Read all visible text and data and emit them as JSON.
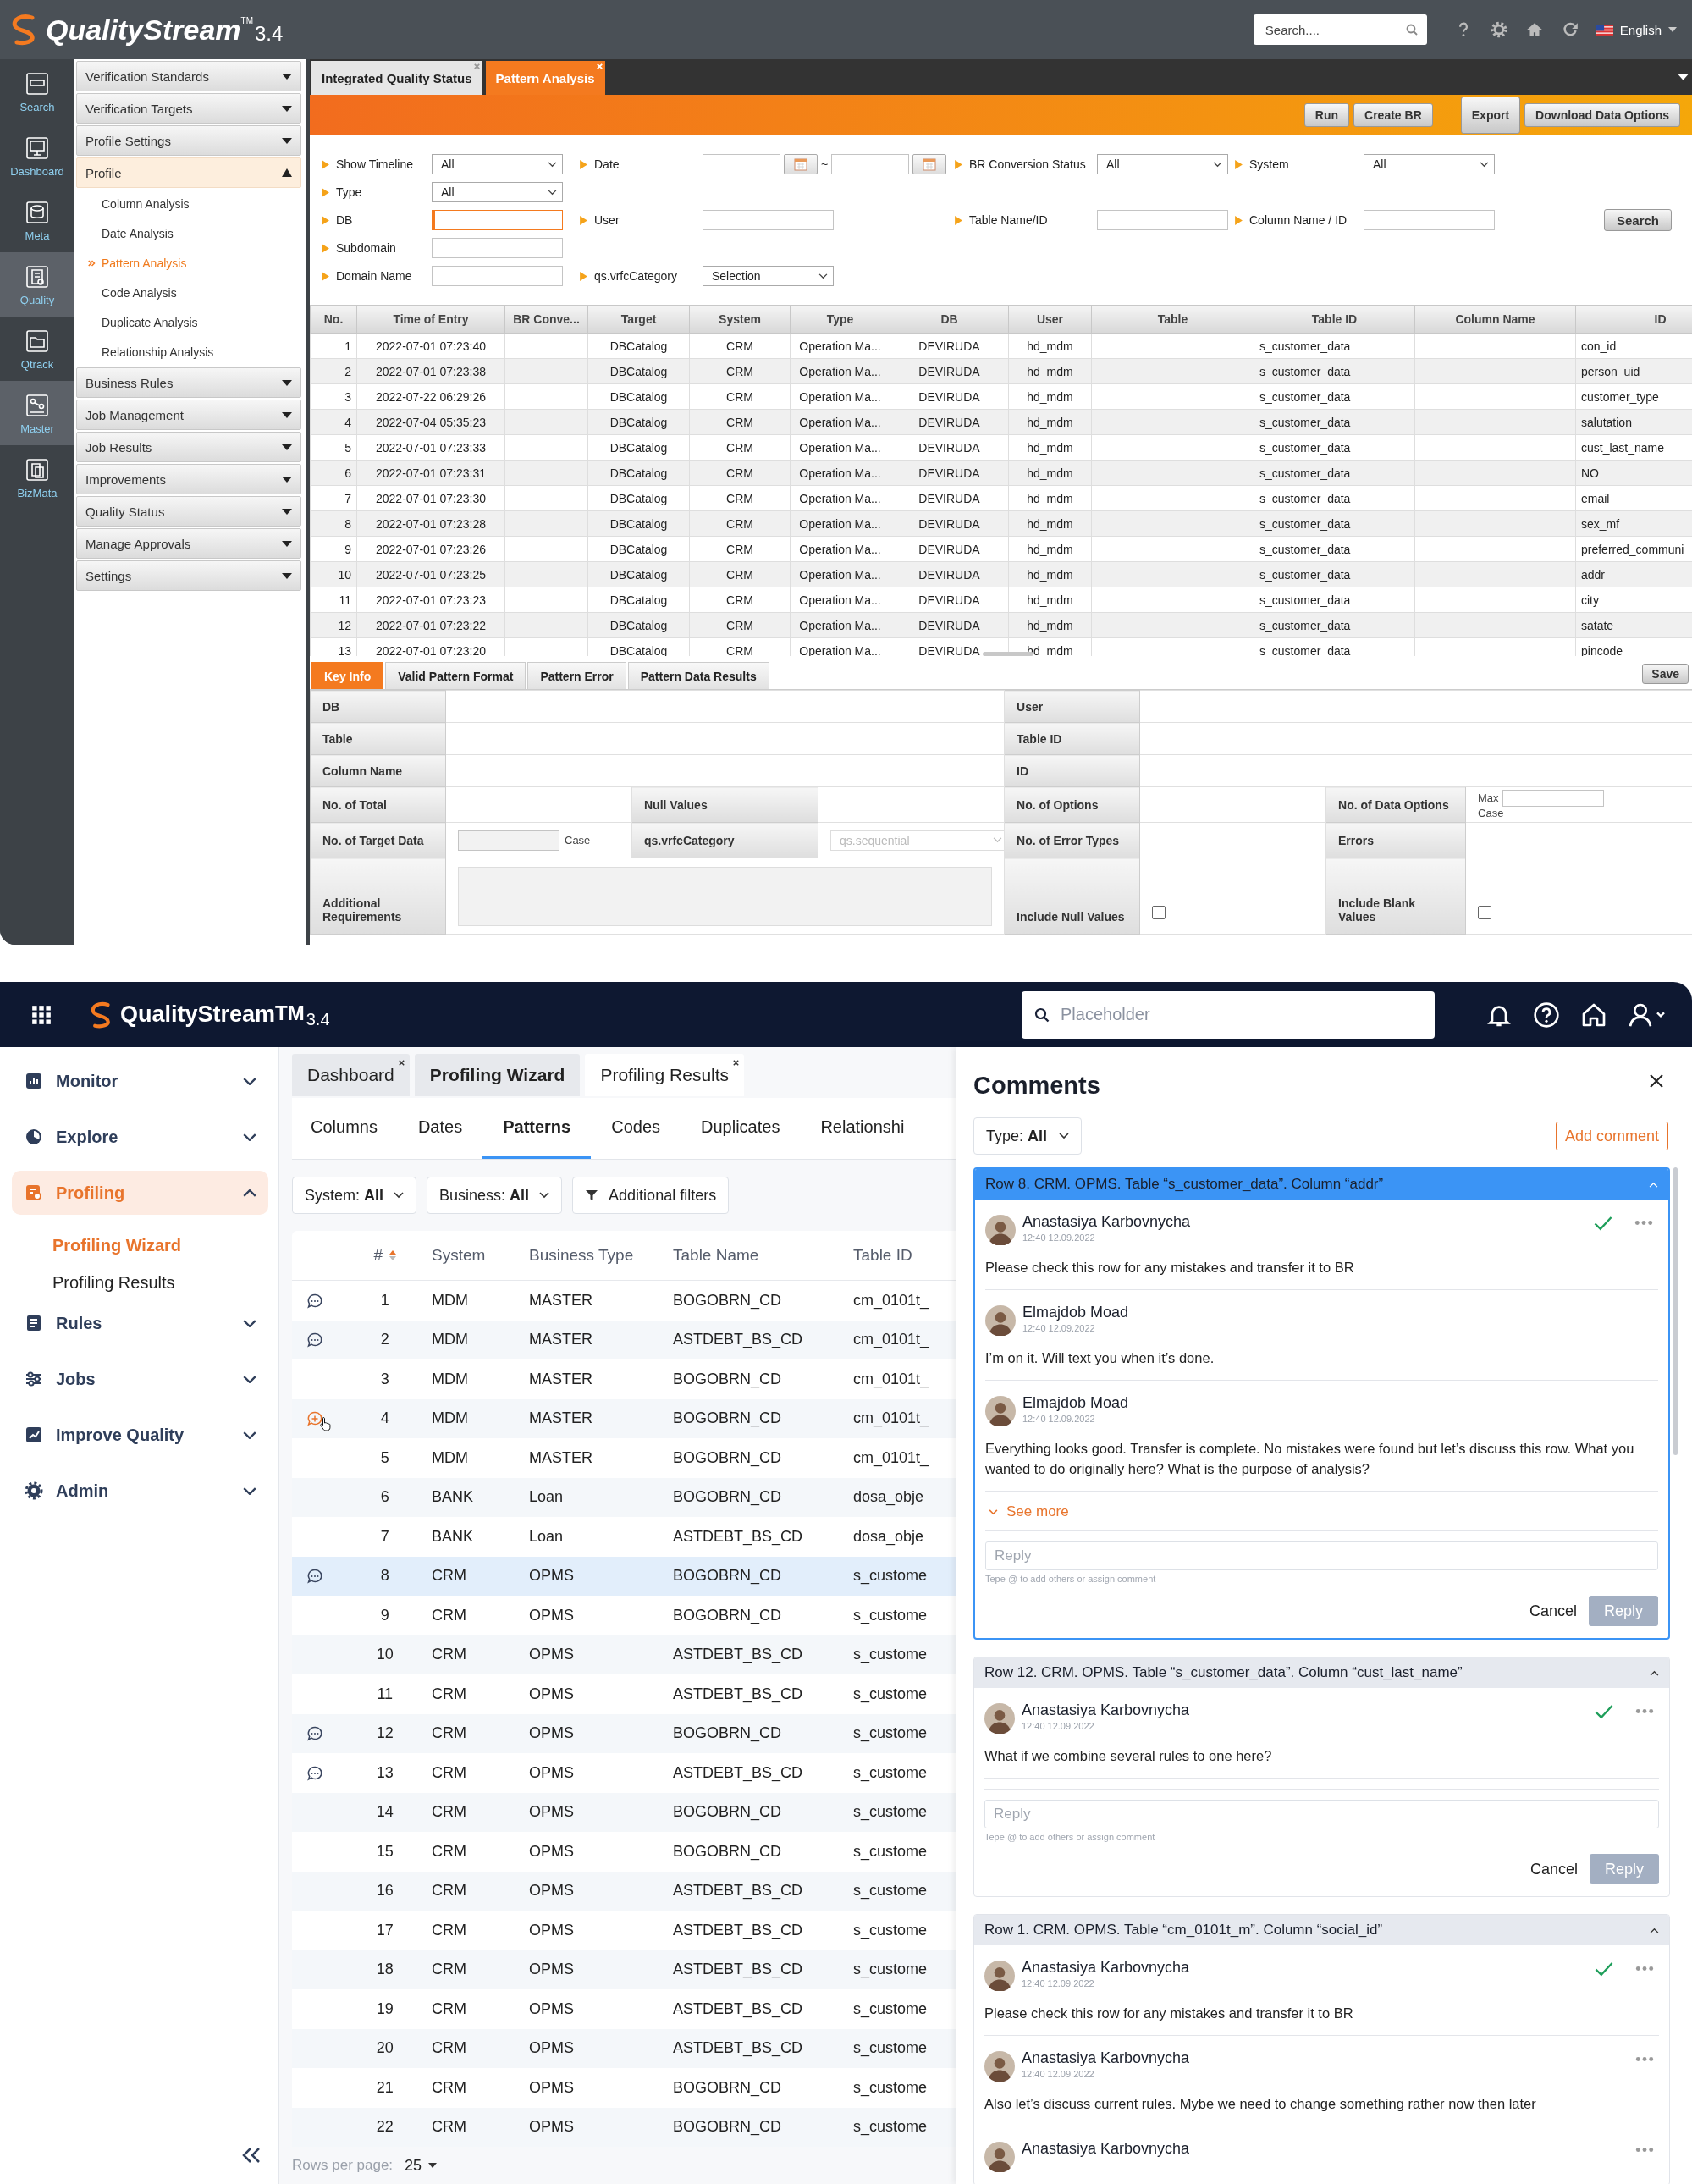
{
  "top": {
    "header": {
      "logo": "QualityStream",
      "logo_mark": "TM",
      "version": "3.4",
      "search": {
        "placeholder": "Search...."
      },
      "language": "English"
    },
    "rail": [
      {
        "label": "Search",
        "highlighted": false
      },
      {
        "label": "Dashboard",
        "highlighted": false
      },
      {
        "label": "Meta",
        "highlighted": false
      },
      {
        "label": "Quality",
        "highlighted": true
      },
      {
        "label": "Qtrack",
        "highlighted": false
      },
      {
        "label": "Master",
        "highlighted": true
      },
      {
        "label": "BizMata",
        "highlighted": false
      }
    ],
    "menu": [
      {
        "label": "Verification Standards",
        "expanded": false
      },
      {
        "label": "Verification Targets",
        "expanded": false
      },
      {
        "label": "Profile Settings",
        "expanded": false
      },
      {
        "label": "Profile",
        "expanded": true,
        "children": [
          {
            "label": "Column Analysis",
            "selected": false
          },
          {
            "label": "Date Analysis",
            "selected": false
          },
          {
            "label": "Pattern Analysis",
            "selected": true
          },
          {
            "label": "Code Analysis",
            "selected": false
          },
          {
            "label": "Duplicate Analysis",
            "selected": false
          },
          {
            "label": "Relationship Analysis",
            "selected": false
          }
        ]
      },
      {
        "label": "Business Rules",
        "expanded": false
      },
      {
        "label": "Job Management",
        "expanded": false
      },
      {
        "label": "Job Results",
        "expanded": false
      },
      {
        "label": "Improvements",
        "expanded": false
      },
      {
        "label": "Quality Status",
        "expanded": false
      },
      {
        "label": "Manage Approvals",
        "expanded": false
      },
      {
        "label": "Settings",
        "expanded": false
      }
    ],
    "tabs": [
      {
        "label": "Integrated Quality Status",
        "selected": false
      },
      {
        "label": "Pattern Analysis",
        "selected": true
      }
    ],
    "actions": [
      "Run",
      "Create BR",
      "Export",
      "Download Data Options"
    ],
    "filters": {
      "rows": [
        [
          {
            "label": "Show Timeline",
            "kind": "select",
            "value": "All"
          },
          {
            "label": "Date",
            "kind": "date-range",
            "separator": "~"
          },
          {
            "label": "BR Conversion Status",
            "kind": "select",
            "value": "All"
          },
          {
            "label": "System",
            "kind": "select",
            "value": "All"
          }
        ],
        [
          {
            "label": "Type",
            "kind": "select",
            "value": "All"
          },
          null,
          null,
          null
        ],
        [
          {
            "label": "DB",
            "kind": "input",
            "focused": true
          },
          {
            "label": "User",
            "kind": "input",
            "focused": false
          },
          {
            "label": "Table Name/ID",
            "kind": "input",
            "focused": false
          },
          {
            "label": "Column Name / ID",
            "kind": "input",
            "focused": false
          }
        ],
        [
          {
            "label": "Subdomain",
            "kind": "input",
            "focused": false
          },
          null,
          null,
          null
        ],
        [
          {
            "label": "Domain Name",
            "kind": "input",
            "focused": false
          },
          {
            "label": "qs.vrfcCategory",
            "kind": "select",
            "value": "Selection"
          },
          null,
          null
        ]
      ],
      "search_button": "Search"
    },
    "table": {
      "columns": [
        "No.",
        "Time of Entry",
        "BR Conve...",
        "Target",
        "System",
        "Type",
        "DB",
        "User",
        "Table",
        "Table ID",
        "Column Name",
        "ID"
      ],
      "rows": [
        {
          "no": "1",
          "time": "2022-07-01 07:23:40",
          "target": "DBCatalog",
          "system": "CRM",
          "type": "Operation Ma...",
          "db": "DEVIRUDA",
          "user": "hd_mdm",
          "table_id": "s_customer_data",
          "id": "con_id"
        },
        {
          "no": "2",
          "time": "2022-07-01 07:23:38",
          "target": "DBCatalog",
          "system": "CRM",
          "type": "Operation Ma...",
          "db": "DEVIRUDA",
          "user": "hd_mdm",
          "table_id": "s_customer_data",
          "id": "person_uid"
        },
        {
          "no": "3",
          "time": "2022-07-22 06:29:26",
          "target": "DBCatalog",
          "system": "CRM",
          "type": "Operation Ma...",
          "db": "DEVIRUDA",
          "user": "hd_mdm",
          "table_id": "s_customer_data",
          "id": "customer_type"
        },
        {
          "no": "4",
          "time": "2022-07-04 05:35:23",
          "target": "DBCatalog",
          "system": "CRM",
          "type": "Operation Ma...",
          "db": "DEVIRUDA",
          "user": "hd_mdm",
          "table_id": "s_customer_data",
          "id": "salutation"
        },
        {
          "no": "5",
          "time": "2022-07-01 07:23:33",
          "target": "DBCatalog",
          "system": "CRM",
          "type": "Operation Ma...",
          "db": "DEVIRUDA",
          "user": "hd_mdm",
          "table_id": "s_customer_data",
          "id": "cust_last_name"
        },
        {
          "no": "6",
          "time": "2022-07-01 07:23:31",
          "target": "DBCatalog",
          "system": "CRM",
          "type": "Operation Ma...",
          "db": "DEVIRUDA",
          "user": "hd_mdm",
          "table_id": "s_customer_data",
          "id": "NO"
        },
        {
          "no": "7",
          "time": "2022-07-01 07:23:30",
          "target": "DBCatalog",
          "system": "CRM",
          "type": "Operation Ma...",
          "db": "DEVIRUDA",
          "user": "hd_mdm",
          "table_id": "s_customer_data",
          "id": "email"
        },
        {
          "no": "8",
          "time": "2022-07-01 07:23:28",
          "target": "DBCatalog",
          "system": "CRM",
          "type": "Operation Ma...",
          "db": "DEVIRUDA",
          "user": "hd_mdm",
          "table_id": "s_customer_data",
          "id": "sex_mf"
        },
        {
          "no": "9",
          "time": "2022-07-01 07:23:26",
          "target": "DBCatalog",
          "system": "CRM",
          "type": "Operation Ma...",
          "db": "DEVIRUDA",
          "user": "hd_mdm",
          "table_id": "s_customer_data",
          "id": "preferred_communi"
        },
        {
          "no": "10",
          "time": "2022-07-01 07:23:25",
          "target": "DBCatalog",
          "system": "CRM",
          "type": "Operation Ma...",
          "db": "DEVIRUDA",
          "user": "hd_mdm",
          "table_id": "s_customer_data",
          "id": "addr"
        },
        {
          "no": "11",
          "time": "2022-07-01 07:23:23",
          "target": "DBCatalog",
          "system": "CRM",
          "type": "Operation Ma...",
          "db": "DEVIRUDA",
          "user": "hd_mdm",
          "table_id": "s_customer_data",
          "id": "city"
        },
        {
          "no": "12",
          "time": "2022-07-01 07:23:22",
          "target": "DBCatalog",
          "system": "CRM",
          "type": "Operation Ma...",
          "db": "DEVIRUDA",
          "user": "hd_mdm",
          "table_id": "s_customer_data",
          "id": "satate"
        },
        {
          "no": "13",
          "time": "2022-07-01 07:23:20",
          "target": "DBCatalog",
          "system": "CRM",
          "type": "Operation Ma...",
          "db": "DEVIRUDA",
          "user": "hd_mdm",
          "table_id": "s_customer_data",
          "id": "pincode"
        }
      ]
    },
    "detail_tabs": [
      {
        "label": "Key Info",
        "selected": true
      },
      {
        "label": "Valid Pattern Format",
        "selected": false
      },
      {
        "label": "Pattern Error",
        "selected": false
      },
      {
        "label": "Pattern Data Results",
        "selected": false
      }
    ],
    "save_button": "Save",
    "form": {
      "db": "DB",
      "user": "User",
      "table": "Table",
      "table_id": "Table ID",
      "column_name": "Column Name",
      "id": "ID",
      "no_total": "No. of Total",
      "null_values": "Null Values",
      "no_options": "No. of Options",
      "no_data_options": "No. of Data Options",
      "max_label": "Max",
      "max_case": "Case",
      "no_target": "No. of Target Data",
      "target_case": "Case",
      "category_label": "qs.vrfcCategory",
      "category_value": "qs.sequential",
      "no_error_types": "No. of Error Types",
      "errors": "Errors",
      "additional": "Additional Requirements",
      "include_null": "Include Null Values",
      "include_null_checked": false,
      "include_blank": "Include Blank Values",
      "include_blank_checked": false
    }
  },
  "bottom": {
    "header": {
      "logo": "QualityStream",
      "logo_mark": "TM",
      "version": "3.4",
      "search": {
        "placeholder": "Placeholder"
      }
    },
    "nav": [
      {
        "label": "Monitor",
        "expanded": false,
        "selected": false
      },
      {
        "label": "Explore",
        "expanded": false,
        "selected": false
      },
      {
        "label": "Profiling",
        "expanded": true,
        "selected": true,
        "children": [
          {
            "label": "Profiling Wizard",
            "selected": true
          },
          {
            "label": "Profiling Results",
            "selected": false
          }
        ]
      },
      {
        "label": "Rules",
        "expanded": false,
        "selected": false
      },
      {
        "label": "Jobs",
        "expanded": false,
        "selected": false
      },
      {
        "label": "Improve Quality",
        "expanded": false,
        "selected": false
      },
      {
        "label": "Admin",
        "expanded": false,
        "selected": false
      }
    ],
    "tabs": [
      {
        "label": "Dashboard",
        "selected": false,
        "closable": true
      },
      {
        "label": "Profiling Wizard",
        "selected": true,
        "closable": false
      },
      {
        "label": "Profiling Results",
        "selected": false,
        "closable": true
      }
    ],
    "subtabs": [
      {
        "label": "Columns",
        "selected": false
      },
      {
        "label": "Dates",
        "selected": false
      },
      {
        "label": "Patterns",
        "selected": true
      },
      {
        "label": "Codes",
        "selected": false
      },
      {
        "label": "Duplicates",
        "selected": false
      },
      {
        "label": "Relationshi",
        "selected": false
      }
    ],
    "filters": [
      "System: **All**",
      "Business: **All**"
    ],
    "additional_filters": "Additional filters",
    "table": {
      "columns": [
        "#",
        "System",
        "Business Type",
        "Table Name",
        "Table ID"
      ],
      "rows": [
        {
          "num": "1",
          "system": "MDM",
          "business_type": "MASTER",
          "table_name": "BOGOBRN_CD",
          "table_id": "cm_0101t_",
          "kind": "comment",
          "selected": false
        },
        {
          "num": "2",
          "system": "MDM",
          "business_type": "MASTER",
          "table_name": "ASTDEBT_BS_CD",
          "table_id": "cm_0101t_",
          "kind": "comment",
          "selected": false
        },
        {
          "num": "3",
          "system": "MDM",
          "business_type": "MASTER",
          "table_name": "BOGOBRN_CD",
          "table_id": "cm_0101t_",
          "selected": false
        },
        {
          "num": "4",
          "system": "MDM",
          "business_type": "MASTER",
          "table_name": "BOGOBRN_CD",
          "table_id": "cm_0101t_",
          "kind": "add-comment",
          "selected": false
        },
        {
          "num": "5",
          "system": "MDM",
          "business_type": "MASTER",
          "table_name": "BOGOBRN_CD",
          "table_id": "cm_0101t_",
          "selected": false
        },
        {
          "num": "6",
          "system": "BANK",
          "business_type": "Loan",
          "table_name": "BOGOBRN_CD",
          "table_id": "dosa_obje",
          "selected": false
        },
        {
          "num": "7",
          "system": "BANK",
          "business_type": "Loan",
          "table_name": "ASTDEBT_BS_CD",
          "table_id": "dosa_obje",
          "selected": false
        },
        {
          "num": "8",
          "system": "CRM",
          "business_type": "OPMS",
          "table_name": "BOGOBRN_CD",
          "table_id": "s_custome",
          "kind": "comment",
          "selected": true
        },
        {
          "num": "9",
          "system": "CRM",
          "business_type": "OPMS",
          "table_name": "BOGOBRN_CD",
          "table_id": "s_custome",
          "selected": false
        },
        {
          "num": "10",
          "system": "CRM",
          "business_type": "OPMS",
          "table_name": "ASTDEBT_BS_CD",
          "table_id": "s_custome",
          "selected": false
        },
        {
          "num": "11",
          "system": "CRM",
          "business_type": "OPMS",
          "table_name": "ASTDEBT_BS_CD",
          "table_id": "s_custome",
          "selected": false
        },
        {
          "num": "12",
          "system": "CRM",
          "business_type": "OPMS",
          "table_name": "BOGOBRN_CD",
          "table_id": "s_custome",
          "kind": "comment",
          "selected": false
        },
        {
          "num": "13",
          "system": "CRM",
          "business_type": "OPMS",
          "table_name": "ASTDEBT_BS_CD",
          "table_id": "s_custome",
          "kind": "comment",
          "selected": false
        },
        {
          "num": "14",
          "system": "CRM",
          "business_type": "OPMS",
          "table_name": "BOGOBRN_CD",
          "table_id": "s_custome",
          "selected": false
        },
        {
          "num": "15",
          "system": "CRM",
          "business_type": "OPMS",
          "table_name": "BOGOBRN_CD",
          "table_id": "s_custome",
          "selected": false
        },
        {
          "num": "16",
          "system": "CRM",
          "business_type": "OPMS",
          "table_name": "ASTDEBT_BS_CD",
          "table_id": "s_custome",
          "selected": false
        },
        {
          "num": "17",
          "system": "CRM",
          "business_type": "OPMS",
          "table_name": "ASTDEBT_BS_CD",
          "table_id": "s_custome",
          "selected": false
        },
        {
          "num": "18",
          "system": "CRM",
          "business_type": "OPMS",
          "table_name": "ASTDEBT_BS_CD",
          "table_id": "s_custome",
          "selected": false
        },
        {
          "num": "19",
          "system": "CRM",
          "business_type": "OPMS",
          "table_name": "ASTDEBT_BS_CD",
          "table_id": "s_custome",
          "selected": false
        },
        {
          "num": "20",
          "system": "CRM",
          "business_type": "OPMS",
          "table_name": "ASTDEBT_BS_CD",
          "table_id": "s_custome",
          "selected": false
        },
        {
          "num": "21",
          "system": "CRM",
          "business_type": "OPMS",
          "table_name": "BOGOBRN_CD",
          "table_id": "s_custome",
          "selected": false
        },
        {
          "num": "22",
          "system": "CRM",
          "business_type": "OPMS",
          "table_name": "BOGOBRN_CD",
          "table_id": "s_custome",
          "selected": false
        }
      ]
    },
    "rows_per_page": {
      "label": "Rows per page:",
      "value": "25"
    },
    "comments": {
      "title": "Comments",
      "type_filter": "Type: **All**",
      "add_button": "Add comment",
      "threads": [
        {
          "title": "Row 8. CRM. OPMS. Table “s_customer_data”. Column “addr”",
          "selected": true,
          "expanded": true,
          "comments": [
            {
              "author": "Anastasiya Karbovnycha",
              "time": "12:40 12.09.2022",
              "text": "Please check this row for any mistakes and transfer it to BR",
              "resolved": true,
              "menu": true
            },
            {
              "author": "Elmajdob Moad",
              "time": "12:40 12.09.2022",
              "text": "I’m on it. Will text you when it’s done.",
              "resolved": false,
              "menu": false
            },
            {
              "author": "Elmajdob Moad",
              "time": "12:40 12.09.2022",
              "text": "Everything looks good. Transfer is complete. No mistakes were found but let’s discuss this row. What you wanted to do originally here? What is the purpose of analysis?",
              "resolved": false,
              "menu": false
            }
          ],
          "see_more": "See more",
          "reply": {
            "placeholder": "Reply",
            "hint": "Tepe @ to add others or assign comment",
            "cancel": "Cancel",
            "submit": "Reply"
          }
        },
        {
          "title": "Row 12. CRM. OPMS. Table “s_customer_data”. Column “cust_last_name”",
          "selected": false,
          "expanded": true,
          "comments": [
            {
              "author": "Anastasiya Karbovnycha",
              "time": "12:40 12.09.2022",
              "text": "What if we combine several rules to one here?",
              "resolved": true,
              "menu": true
            }
          ],
          "reply": {
            "placeholder": "Reply",
            "hint": "Tepe @ to add others or assign comment",
            "cancel": "Cancel",
            "submit": "Reply"
          }
        },
        {
          "title": "Row 1. CRM. OPMS. Table “cm_0101t_m”. Column “social_id”",
          "selected": false,
          "expanded": true,
          "comments": [
            {
              "author": "Anastasiya Karbovnycha",
              "time": "12:40 12.09.2022",
              "text": "Please check this row for any mistakes and transfer it to BR",
              "resolved": true,
              "menu": true
            },
            {
              "author": "Anastasiya Karbovnycha",
              "time": "12:40 12.09.2022",
              "text": "Also let’s discuss current rules. Mybe we need to change something rather now then later",
              "resolved": false,
              "menu": true
            },
            {
              "author": "Anastasiya Karbovnycha",
              "resolved": false,
              "menu": true
            }
          ]
        }
      ]
    }
  }
}
